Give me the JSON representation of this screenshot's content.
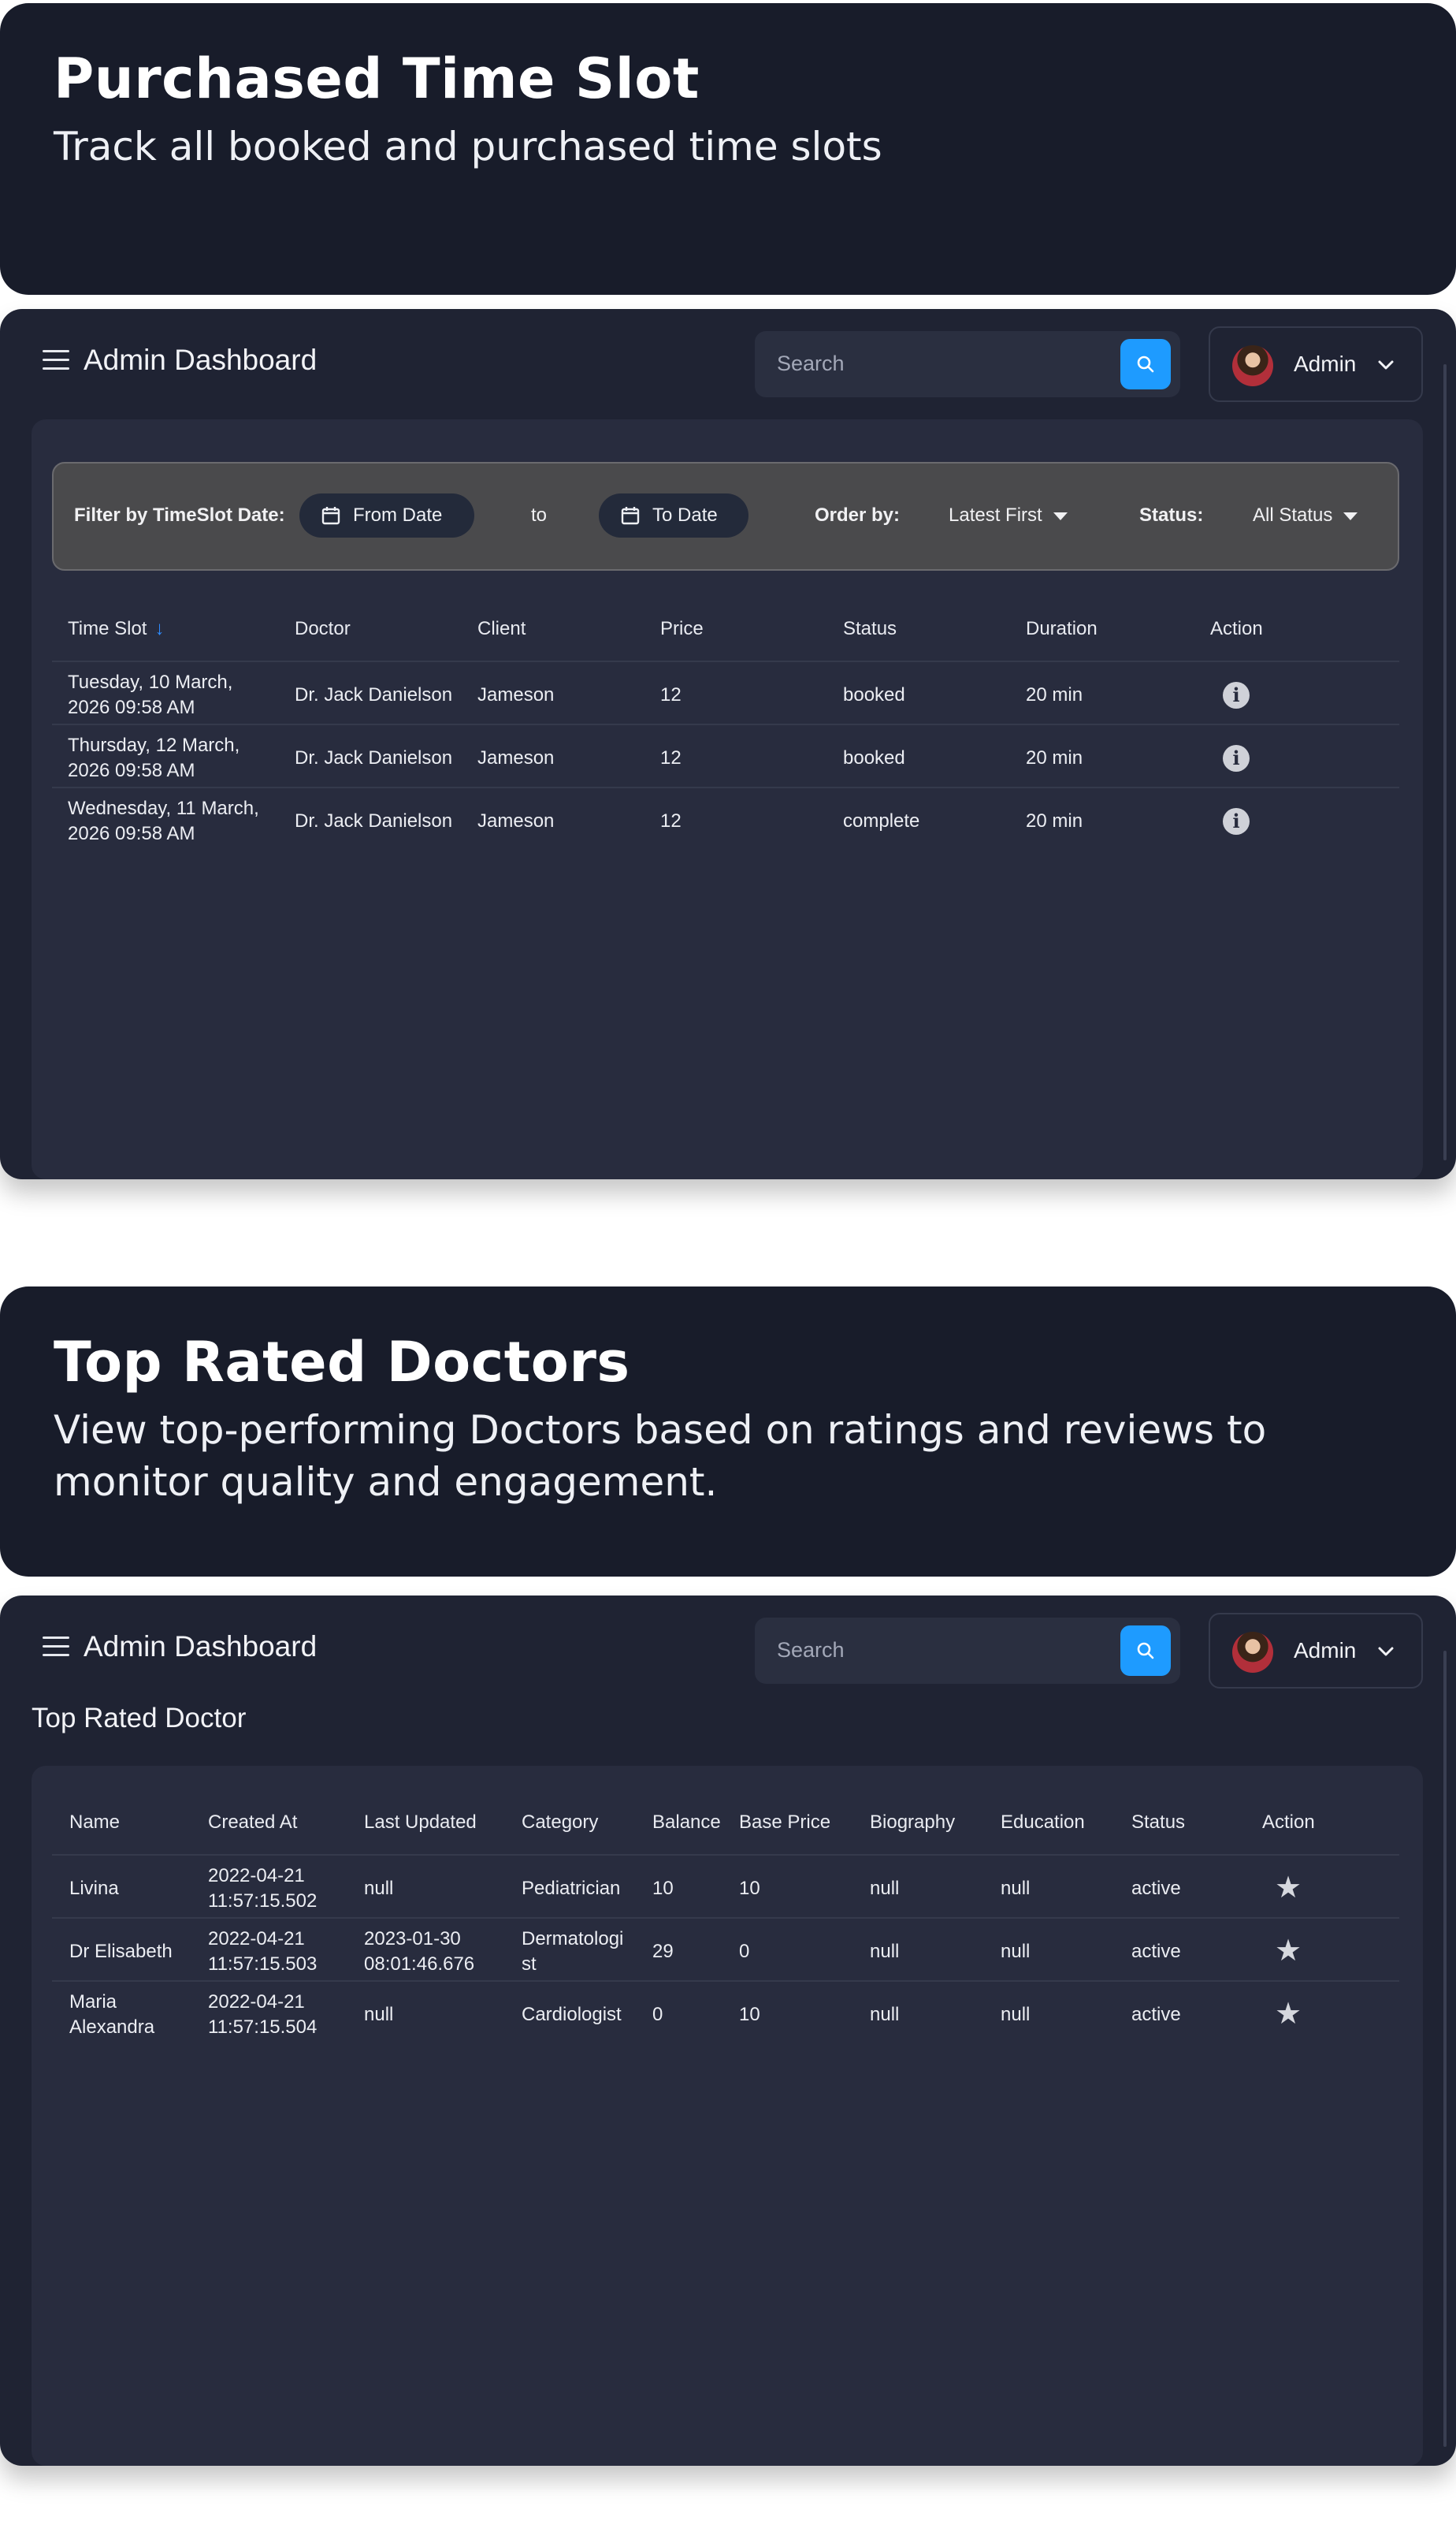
{
  "section1": {
    "title": "Purchased Time Slot",
    "subtitle": "Track all booked and purchased time slots"
  },
  "section2": {
    "title": "Top Rated Doctors",
    "subtitle_line1": "View top-performing Doctors based on ratings and reviews to",
    "subtitle_line2": "monitor quality and engagement."
  },
  "topbar": {
    "menu_icon": "hamburger-icon",
    "title": "Admin Dashboard",
    "search_placeholder": "Search",
    "search_icon": "search-icon",
    "user_name": "Admin",
    "user_chevron": "chevron-down-icon",
    "accent": "#1e9bff"
  },
  "timeslots": {
    "filter": {
      "label": "Filter by TimeSlot Date:",
      "from_date": "From Date",
      "to_text": "to",
      "to_date": "To Date",
      "order_label": "Order by:",
      "order_value": "Latest First",
      "status_label": "Status:",
      "status_value": "All Status"
    },
    "columns": [
      "Time Slot",
      "Doctor",
      "Client",
      "Price",
      "Status",
      "Duration",
      "Action"
    ],
    "rows": [
      {
        "time_line1": "Tuesday, 10 March,",
        "time_line2": "2026 09:58 AM",
        "doctor": "Dr. Jack Danielson",
        "client": "Jameson",
        "price": "12",
        "status": "booked",
        "duration": "20 min",
        "action_icon": "info-icon"
      },
      {
        "time_line1": "Thursday, 12 March,",
        "time_line2": "2026 09:58 AM",
        "doctor": "Dr. Jack Danielson",
        "client": "Jameson",
        "price": "12",
        "status": "booked",
        "duration": "20 min",
        "action_icon": "info-icon"
      },
      {
        "time_line1": "Wednesday, 11 March,",
        "time_line2": "2026 09:58 AM",
        "doctor": "Dr. Jack Danielson",
        "client": "Jameson",
        "price": "12",
        "status": "complete",
        "duration": "20 min",
        "action_icon": "info-icon"
      }
    ]
  },
  "doctors": {
    "heading": "Top Rated Doctor",
    "columns": [
      "Name",
      "Created At",
      "Last Updated",
      "Category",
      "Balance",
      "Base Price",
      "Biography",
      "Education",
      "Status",
      "Action"
    ],
    "rows": [
      {
        "name_line1": "Livina",
        "name_line2": "",
        "created_line1": "2022-04-21",
        "created_line2": "11:57:15.502",
        "updated_line1": "null",
        "updated_line2": "",
        "category_line1": "Pediatrician",
        "category_line2": "",
        "balance": "10",
        "base_price": "10",
        "biography": "null",
        "education": "null",
        "status": "active",
        "action_icon": "star-icon"
      },
      {
        "name_line1": "Dr Elisabeth",
        "name_line2": "",
        "created_line1": "2022-04-21",
        "created_line2": "11:57:15.503",
        "updated_line1": "2023-01-30",
        "updated_line2": "08:01:46.676",
        "category_line1": "Dermatologi",
        "category_line2": "st",
        "balance": "29",
        "base_price": "0",
        "biography": "null",
        "education": "null",
        "status": "active",
        "action_icon": "star-icon"
      },
      {
        "name_line1": "Maria",
        "name_line2": "Alexandra",
        "created_line1": "2022-04-21",
        "created_line2": "11:57:15.504",
        "updated_line1": "null",
        "updated_line2": "",
        "category_line1": "Cardiologist",
        "category_line2": "",
        "balance": "0",
        "base_price": "10",
        "biography": "null",
        "education": "null",
        "status": "active",
        "action_icon": "star-icon"
      }
    ]
  }
}
